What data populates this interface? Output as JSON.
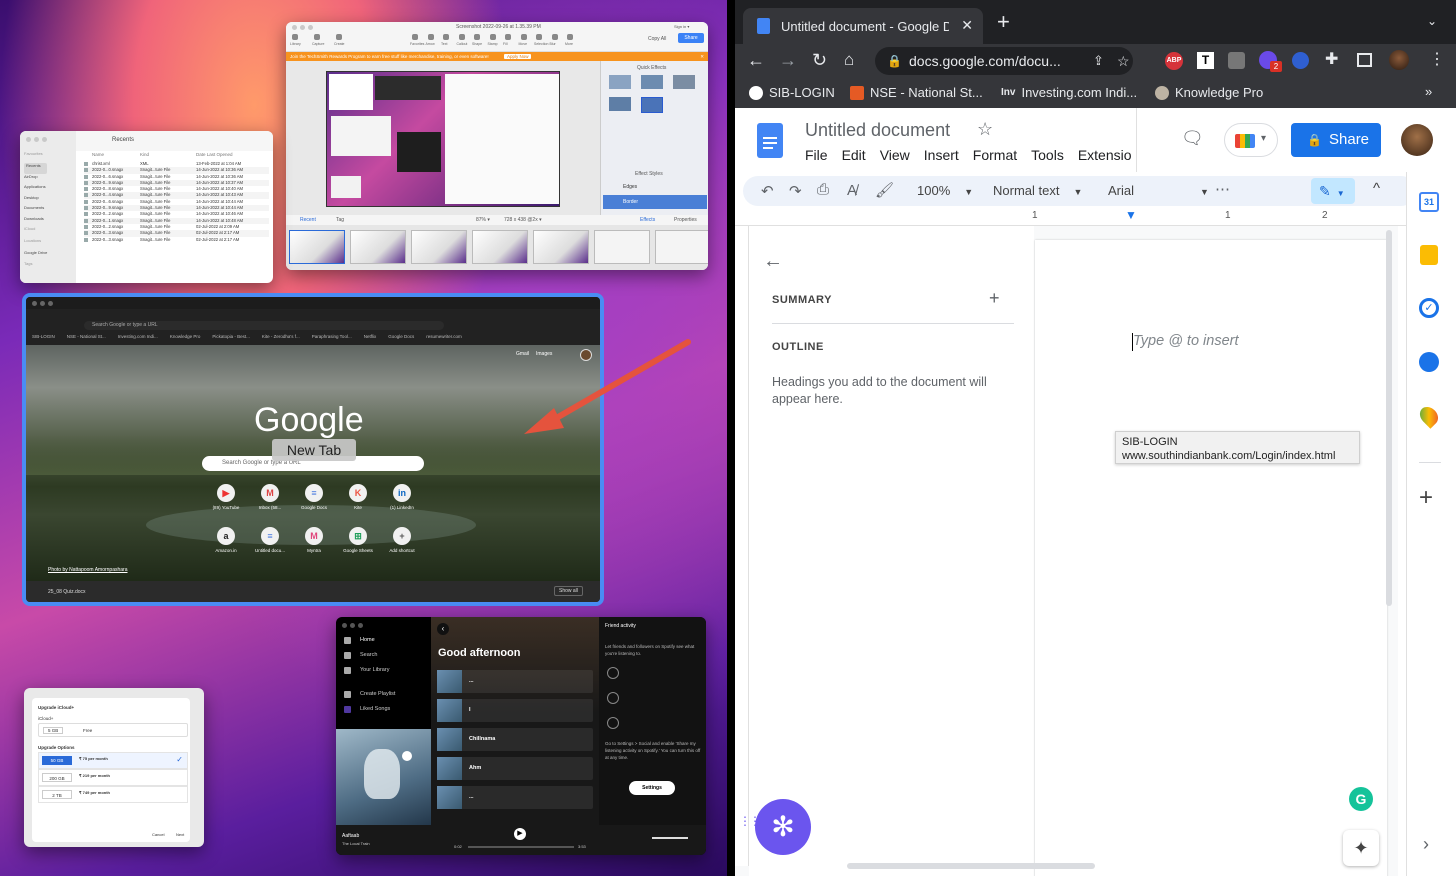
{
  "snagit": {
    "title": "Screenshot 2022-09-26 at 1.35.39 PM",
    "sign_in": "Sign in ▾",
    "copy_all": "Copy All",
    "share": "Share",
    "banner": "Join the TechSmith Rewards Program to earn free stuff like merchandise, training, or even software!",
    "apply_now": "Apply Now",
    "quick_effects": "Quick Effects",
    "effect_styles": "Effect Styles",
    "edges": "Edges",
    "border": "Border",
    "recent": "Recent",
    "tag": "Tag",
    "zoom": "87% ▾",
    "dims": "728 x 438 @2x ▾",
    "effects": "Effects",
    "properties": "Properties",
    "tools": [
      "Library",
      "Capture",
      "Create",
      "Favorites",
      "Arrow",
      "Text",
      "Callout",
      "Shape",
      "Stamp",
      "Fill",
      "Move",
      "Selection",
      "Blur",
      "More"
    ]
  },
  "finder": {
    "title": "Recents",
    "sidebar": [
      "Favourites",
      "Recents",
      "AirDrop",
      "Applications",
      "Desktop",
      "Documents",
      "Downloads",
      "iCloud",
      "Locations",
      "Google Drive",
      "Tags"
    ],
    "cols": [
      "Name",
      "Kind",
      "Date Last Opened"
    ],
    "rows": [
      [
        "christ.xml",
        "XML",
        "13-Feb-2022 at 1:04 AM"
      ],
      [
        "2022-0...0.snagx",
        "Snagit...ture File",
        "14-Jun-2022 at 10:36 AM"
      ],
      [
        "2022-0...6.snagx",
        "Snagit...ture File",
        "14-Jun-2022 at 10:36 AM"
      ],
      [
        "2022-0...9.snagx",
        "Snagit...ture File",
        "14-Jun-2022 at 10:37 AM"
      ],
      [
        "2022-0...8.snagx",
        "Snagit...ture File",
        "14-Jun-2022 at 10:40 AM"
      ],
      [
        "2022-0...4.snagx",
        "Snagit...ture File",
        "14-Jun-2022 at 10:43 AM"
      ],
      [
        "2022-0...6.snagx",
        "Snagit...ture File",
        "14-Jun-2022 at 10:44 AM"
      ],
      [
        "2022-0...9.snagx",
        "Snagit...ture File",
        "14-Jun-2022 at 10:44 AM"
      ],
      [
        "2022-0...2.snagx",
        "Snagit...ture File",
        "14-Jun-2022 at 10:46 AM"
      ],
      [
        "2022-0...1.snagx",
        "Snagit...ture File",
        "14-Jun-2022 at 10:48 AM"
      ],
      [
        "2022-0...2.snagx",
        "Snagit...ture File",
        "02-Jul-2022 at 2:09 AM"
      ],
      [
        "2022-0...3.snagx",
        "Snagit...ture File",
        "02-Jul-2022 at 2:17 AM"
      ],
      [
        "2022-0...3.snagx",
        "Snagit...ture File",
        "02-Jul-2022 at 2:17 AM"
      ]
    ]
  },
  "chromemini": {
    "omni": "Search Google or type a URL",
    "gmail": "Gmail",
    "images": "Images",
    "logo": "Google",
    "search": "Search Google or type a URL",
    "tooltip": "New Tab",
    "photo": "Photo by Nattapoom Amornpashara",
    "download": "25_08 Quiz.docx",
    "show_all": "Show all",
    "bookmarks": [
      "SIB-LOGIN",
      "NSE - National St...",
      "Investing.com Indi...",
      "Knowledge Pro",
      "Pickatopia - Best...",
      "Kite - Zerodha's f...",
      "Paraphrasing Tool...",
      "Netflix",
      "Google Docs",
      "resumewriter.com"
    ],
    "shortcuts": [
      {
        "label": "(89) YouTube",
        "glyph": "▶",
        "color": "#e33"
      },
      {
        "label": "Inbox (58...",
        "glyph": "M",
        "color": "#d44"
      },
      {
        "label": "Google Docs",
        "glyph": "≡",
        "color": "#4a7be0"
      },
      {
        "label": "Kite",
        "glyph": "K",
        "color": "#e54"
      },
      {
        "label": "(1) LinkedIn",
        "glyph": "in",
        "color": "#0a66c2"
      },
      {
        "label": "Amazon.in",
        "glyph": "a",
        "color": "#222"
      },
      {
        "label": "Untitled docu...",
        "glyph": "≡",
        "color": "#4a7be0"
      },
      {
        "label": "Myntra",
        "glyph": "M",
        "color": "#e0457b"
      },
      {
        "label": "Google Sheets",
        "glyph": "⊞",
        "color": "#1e9e5a"
      },
      {
        "label": "Add shortcut",
        "glyph": "+",
        "color": "#555"
      }
    ]
  },
  "icloud": {
    "title": "Upgrade iCloud+",
    "current": "iCloud+",
    "plans_label": "Upgrade Options",
    "free_size": "5 GB",
    "free": "Free",
    "plans": [
      {
        "size": "50 GB",
        "price": "₹ 75 per month"
      },
      {
        "size": "200 GB",
        "price": "₹ 219 per month"
      },
      {
        "size": "2 TB",
        "price": "₹ 749 per month"
      }
    ],
    "cancel": "Cancel",
    "next": "Next"
  },
  "spotify": {
    "nav": [
      "Home",
      "Search",
      "Your Library",
      "Create Playlist",
      "Liked Songs"
    ],
    "greeting": "Good afternoon",
    "tracks": [
      "...",
      "I",
      "Chillnama",
      "Ahm",
      "..."
    ],
    "friend_title": "Friend activity",
    "friend_text": "Let friends and followers on Spotify see what you're listening to.",
    "settings_text": "Go to Settings > Social and enable 'Share my listening activity on Spotify.' You can turn this off at any time.",
    "settings_btn": "Settings",
    "now_title": "Aaftaab",
    "now_artist": "The Local Train",
    "t_start": "0:02",
    "t_end": "3:53"
  },
  "chrome": {
    "tab_title": "Untitled document - Google Do",
    "url": "docs.google.com/docu...",
    "bookmarks": [
      "SIB-LOGIN",
      "NSE - National St...",
      "Investing.com Indi...",
      "Knowledge Pro"
    ],
    "badge": "2"
  },
  "docs": {
    "title": "Untitled document",
    "menu": [
      "File",
      "Edit",
      "View",
      "Insert",
      "Format",
      "Tools",
      "Extensio"
    ],
    "share": "Share",
    "zoom": "100%",
    "style": "Normal text",
    "font": "Arial",
    "summary": "SUMMARY",
    "outline": "OUTLINE",
    "outline_hint": "Headings you add to the document will appear here.",
    "placeholder": "Type @ to insert",
    "tooltip_title": "SIB-LOGIN",
    "tooltip_url": "www.southindianbank.com/Login/index.html",
    "calendar_day": "31"
  },
  "colors": {
    "docs_blue": "#1a73e8",
    "chrome_dark": "#202124",
    "spotify_green": "#1db954"
  }
}
